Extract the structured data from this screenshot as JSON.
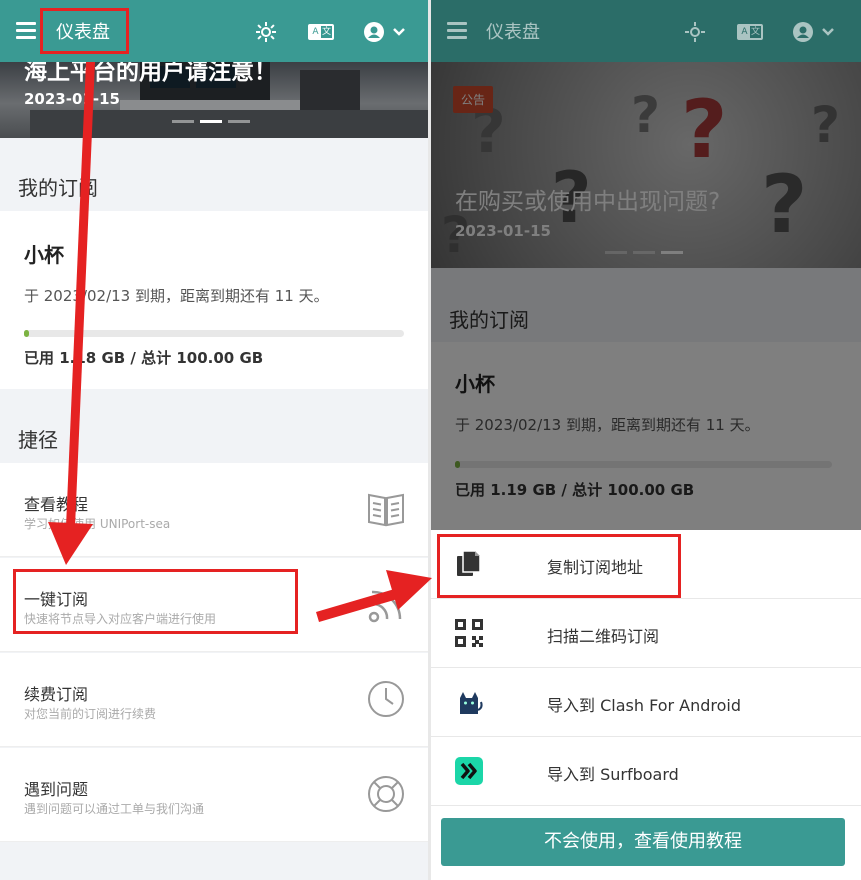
{
  "header": {
    "title": "仪表盘",
    "lang_left": "A",
    "lang_right": "文"
  },
  "left": {
    "hero": {
      "title": "海上平台的用户请注意！",
      "date": "2023-01-15"
    },
    "subscription_section": "我的订阅",
    "plan": {
      "name": "小杯",
      "expiry": "于 2023/02/13 到期，距离到期还有 11 天。",
      "usage": "已用 1.18 GB / 总计 100.00 GB",
      "usage_fraction": 0.012
    },
    "shortcuts_section": "捷径",
    "shortcuts": [
      {
        "title": "查看教程",
        "desc": "学习如何使用 UNIPort-sea",
        "icon": "book-icon"
      },
      {
        "title": "一键订阅",
        "desc": "快速将节点导入对应客户端进行使用",
        "icon": "rss-icon"
      },
      {
        "title": "续费订阅",
        "desc": "对您当前的订阅进行续费",
        "icon": "clock-icon"
      },
      {
        "title": "遇到问题",
        "desc": "遇到问题可以通过工单与我们沟通",
        "icon": "lifebuoy-icon"
      }
    ]
  },
  "right": {
    "hero": {
      "badge": "公告",
      "title": "在购买或使用中出现问题?",
      "date": "2023-01-15"
    },
    "subscription_section": "我的订阅",
    "plan": {
      "name": "小杯",
      "expiry": "于 2023/02/13 到期，距离到期还有 11 天。",
      "usage": "已用 1.19 GB / 总计 100.00 GB",
      "usage_fraction": 0.012
    },
    "sheet": [
      {
        "label": "复制订阅地址",
        "icon": "copy-icon"
      },
      {
        "label": "扫描二维码订阅",
        "icon": "qrcode-icon"
      },
      {
        "label": "导入到 Clash For Android",
        "icon": "clash-icon"
      },
      {
        "label": "导入到 Surfboard",
        "icon": "surfboard-icon"
      }
    ],
    "tutorial_button": "不会使用，查看使用教程"
  },
  "colors": {
    "header": "#3a9a93",
    "annotation_red": "#e52222",
    "progress": "#7cb342"
  }
}
